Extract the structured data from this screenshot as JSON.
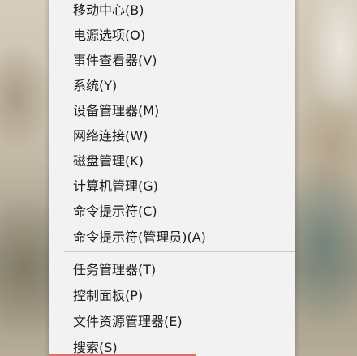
{
  "menu": {
    "items": [
      {
        "label": "移动中心(B)"
      },
      {
        "label": "电源选项(O)"
      },
      {
        "label": "事件查看器(V)"
      },
      {
        "label": "系统(Y)"
      },
      {
        "label": "设备管理器(M)"
      },
      {
        "label": "网络连接(W)"
      },
      {
        "label": "磁盘管理(K)"
      },
      {
        "label": "计算机管理(G)"
      },
      {
        "label": "命令提示符(C)"
      },
      {
        "label": "命令提示符(管理员)(A)"
      },
      {
        "label": "任务管理器(T)"
      },
      {
        "label": "控制面板(P)"
      },
      {
        "label": "文件资源管理器(E)"
      },
      {
        "label": "搜索(S)"
      }
    ]
  }
}
